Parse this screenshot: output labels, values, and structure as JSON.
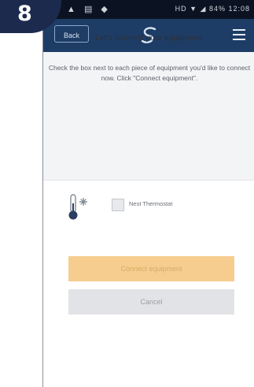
{
  "step_badge": {
    "number": "8"
  },
  "status_bar": {
    "left_icons": "▲ ▤ ◆",
    "right_text": "HD ▼ ◢ 84% 12:08"
  },
  "app_bar": {
    "back_label": "Back",
    "logo": "swirl-logo-icon",
    "menu": "hamburger-menu-icon"
  },
  "main": {
    "title": "Let's connect your equipment",
    "instructions": "Check the box next to each piece of equipment you'd like to connect now. Click \"Connect equipment\"."
  },
  "equipment": [
    {
      "label": "Nest Thermostat",
      "checked": false,
      "icon": "thermostat-icon"
    }
  ],
  "actions": {
    "connect_label": "Connect equipment",
    "cancel_label": "Cancel"
  },
  "colors": {
    "app_bar": "#1d3d67",
    "badge": "#1c2b4d",
    "connect_button": "#f6cd8f",
    "cancel_button": "#e2e3e6"
  }
}
